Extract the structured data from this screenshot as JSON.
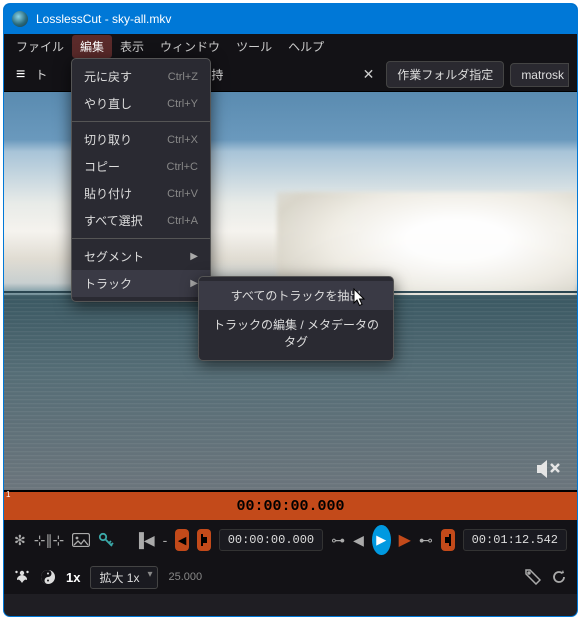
{
  "window": {
    "title": "LosslessCut - sky-all.mkv"
  },
  "menubar": {
    "items": [
      "ファイル",
      "編集",
      "表示",
      "ウィンドウ",
      "ツール",
      "ヘルプ"
    ],
    "activeIndex": 1
  },
  "toolbar": {
    "left_fragment": "ト",
    "keep_label": "を保持",
    "workdir_btn": "作業フォルダ指定",
    "format_btn": "matrosk"
  },
  "edit_menu": {
    "items": [
      {
        "label": "元に戻す",
        "shortcut": "Ctrl+Z"
      },
      {
        "label": "やり直し",
        "shortcut": "Ctrl+Y"
      },
      {
        "sep": true
      },
      {
        "label": "切り取り",
        "shortcut": "Ctrl+X"
      },
      {
        "label": "コピー",
        "shortcut": "Ctrl+C"
      },
      {
        "label": "貼り付け",
        "shortcut": "Ctrl+V"
      },
      {
        "label": "すべて選択",
        "shortcut": "Ctrl+A"
      },
      {
        "sep": true
      },
      {
        "label": "セグメント",
        "submenu": true
      },
      {
        "label": "トラック",
        "submenu": true,
        "hover": true
      }
    ]
  },
  "track_submenu": {
    "items": [
      {
        "label": "すべてのトラックを抽出",
        "hover": true
      },
      {
        "label": "トラックの編集 / メタデータのタグ"
      }
    ]
  },
  "timeline": {
    "marker": "1",
    "timecode": "00:00:00.000"
  },
  "controls": {
    "current_time": "00:00:00.000",
    "end_time": "00:01:12.542",
    "dash": "-"
  },
  "bottom": {
    "speed": "1x",
    "zoom": "拡大 1x",
    "fps": "25.000"
  }
}
